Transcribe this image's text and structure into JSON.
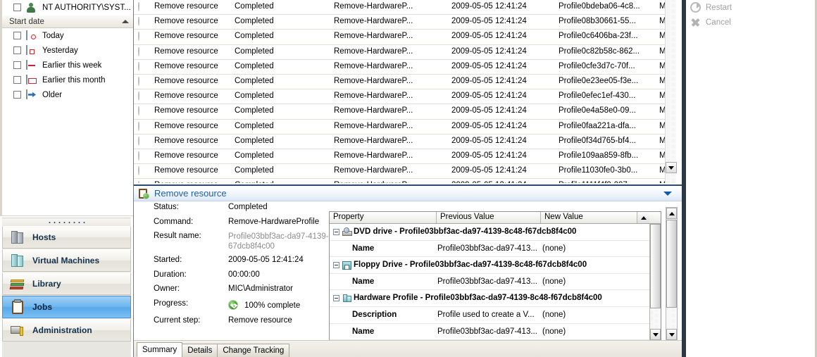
{
  "sidebar": {
    "owner_filter": {
      "label": "NT AUTHORITY\\SYST...",
      "icon": "user-icon",
      "checked": false
    },
    "group": {
      "title": "Start date",
      "chevron": "chevron-up-icon"
    },
    "date_filters": [
      {
        "label": "Today",
        "icon": "calendar-today-icon",
        "checked": false
      },
      {
        "label": "Yesterday",
        "icon": "calendar-yesterday-icon",
        "checked": false
      },
      {
        "label": "Earlier this week",
        "icon": "calendar-week-icon",
        "checked": false
      },
      {
        "label": "Earlier this month",
        "icon": "calendar-month-icon",
        "checked": false
      },
      {
        "label": "Older",
        "icon": "calendar-older-icon",
        "checked": false
      }
    ],
    "nav": [
      {
        "label": "Hosts",
        "icon": "servers-icon",
        "active": false
      },
      {
        "label": "Virtual Machines",
        "icon": "virtual-servers-icon",
        "active": false
      },
      {
        "label": "Library",
        "icon": "books-icon",
        "active": false
      },
      {
        "label": "Jobs",
        "icon": "clipboard-icon",
        "active": true
      },
      {
        "label": "Administration",
        "icon": "admin-tools-icon",
        "active": false
      }
    ]
  },
  "job_list": {
    "status_icon": "success-check-icon",
    "rows": [
      {
        "name": "Remove resource",
        "status": "Completed",
        "command": "Remove-HardwareP...",
        "start": "2009-05-05 12:41:24",
        "result": "Profile0bdeba06-4c8...",
        "owner": "MIC\\Administrator"
      },
      {
        "name": "Remove resource",
        "status": "Completed",
        "command": "Remove-HardwareP...",
        "start": "2009-05-05 12:41:24",
        "result": "Profile08b30661-55...",
        "owner": "MIC\\Administrator"
      },
      {
        "name": "Remove resource",
        "status": "Completed",
        "command": "Remove-HardwareP...",
        "start": "2009-05-05 12:41:24",
        "result": "Profile0c6406ba-23f...",
        "owner": "MIC\\Administrator"
      },
      {
        "name": "Remove resource",
        "status": "Completed",
        "command": "Remove-HardwareP...",
        "start": "2009-05-05 12:41:24",
        "result": "Profile0c82b58c-862...",
        "owner": "MIC\\Administrator"
      },
      {
        "name": "Remove resource",
        "status": "Completed",
        "command": "Remove-HardwareP...",
        "start": "2009-05-05 12:41:24",
        "result": "Profile0cfe3d7c-70f...",
        "owner": "MIC\\Administrator"
      },
      {
        "name": "Remove resource",
        "status": "Completed",
        "command": "Remove-HardwareP...",
        "start": "2009-05-05 12:41:24",
        "result": "Profile0e23ee05-f3e...",
        "owner": "MIC\\Administrator"
      },
      {
        "name": "Remove resource",
        "status": "Completed",
        "command": "Remove-HardwareP...",
        "start": "2009-05-05 12:41:24",
        "result": "Profile0efec1ef-430...",
        "owner": "MIC\\Administrator"
      },
      {
        "name": "Remove resource",
        "status": "Completed",
        "command": "Remove-HardwareP...",
        "start": "2009-05-05 12:41:24",
        "result": "Profile0e4a58e0-09...",
        "owner": "MIC\\Administrator"
      },
      {
        "name": "Remove resource",
        "status": "Completed",
        "command": "Remove-HardwareP...",
        "start": "2009-05-05 12:41:24",
        "result": "Profile0faa221a-dfa...",
        "owner": "MIC\\Administrator"
      },
      {
        "name": "Remove resource",
        "status": "Completed",
        "command": "Remove-HardwareP...",
        "start": "2009-05-05 12:41:24",
        "result": "Profile0f34d765-bf4...",
        "owner": "MIC\\Administrator"
      },
      {
        "name": "Remove resource",
        "status": "Completed",
        "command": "Remove-HardwareP...",
        "start": "2009-05-05 12:41:24",
        "result": "Profile109aa859-8fb...",
        "owner": "MIC\\Administrator"
      },
      {
        "name": "Remove resource",
        "status": "Completed",
        "command": "Remove-HardwareP...",
        "start": "2009-05-05 12:41:24",
        "result": "Profile11030fe0-3b0...",
        "owner": "MIC\\Administrator"
      }
    ]
  },
  "details": {
    "header": {
      "title": "Remove resource",
      "icon": "job-success-icon",
      "chevron": "chevron-down-icon"
    },
    "summary": [
      {
        "label": "Status:",
        "value": "Completed",
        "grey": false
      },
      {
        "label": "Command:",
        "value": "Remove-HardwareProfile",
        "grey": false
      },
      {
        "label": "Result name:",
        "value": "Profile03bbf3ac-da97-4139-8c48-f67dcb8f4c00",
        "grey": true
      },
      {
        "label": "Started:",
        "value": "2009-05-05 12:41:24",
        "grey": false
      },
      {
        "label": "Duration:",
        "value": "00:00:00",
        "grey": false
      },
      {
        "label": "Owner:",
        "value": "MIC\\Administrator",
        "grey": false
      },
      {
        "label": "Progress:",
        "value": "100% complete",
        "grey": false,
        "icon": "success-check-icon"
      },
      {
        "label": "Current step:",
        "value": "Remove resource",
        "grey": false
      }
    ],
    "grid": {
      "columns": [
        "Property",
        "Previous Value",
        "New Value"
      ],
      "rows": [
        {
          "type": "group",
          "name": "DVD drive - Profile03bbf3ac-da97-4139-8c48-f67dcb8f4c00",
          "icon": "dvd-drive-icon",
          "previous": "",
          "new": ""
        },
        {
          "type": "item",
          "name": "Name",
          "previous": "Profile03bbf3ac-da97-413...",
          "new": "(none)"
        },
        {
          "type": "group",
          "name": "Floppy Drive - Profile03bbf3ac-da97-4139-8c48-f67dcb8f4c00",
          "icon": "floppy-drive-icon",
          "previous": "",
          "new": ""
        },
        {
          "type": "item",
          "name": "Name",
          "previous": "Profile03bbf3ac-da97-413...",
          "new": "(none)"
        },
        {
          "type": "group",
          "name": "Hardware Profile - Profile03bbf3ac-da97-4139-8c48-f67dcb8f4c00",
          "icon": "hardware-profile-icon",
          "previous": "",
          "new": ""
        },
        {
          "type": "item",
          "name": "Description",
          "previous": "Profile used to create a V...",
          "new": "(none)"
        },
        {
          "type": "item",
          "name": "Name",
          "previous": "Profile03bbf3ac-da97-413...",
          "new": "(none)"
        }
      ]
    },
    "tabs": [
      {
        "label": "Summary",
        "selected": true
      },
      {
        "label": "Details",
        "selected": false
      },
      {
        "label": "Change Tracking",
        "selected": false
      }
    ]
  },
  "actions": [
    {
      "label": "Restart",
      "icon": "restart-icon",
      "disabled": true
    },
    {
      "label": "Cancel",
      "icon": "cancel-x-icon",
      "disabled": true
    }
  ],
  "colors": {
    "accent": "#1d5fa8",
    "selected_nav": "#6fb6ee",
    "success": "#3aa81e",
    "disabled_text": "#a0a0a0"
  }
}
